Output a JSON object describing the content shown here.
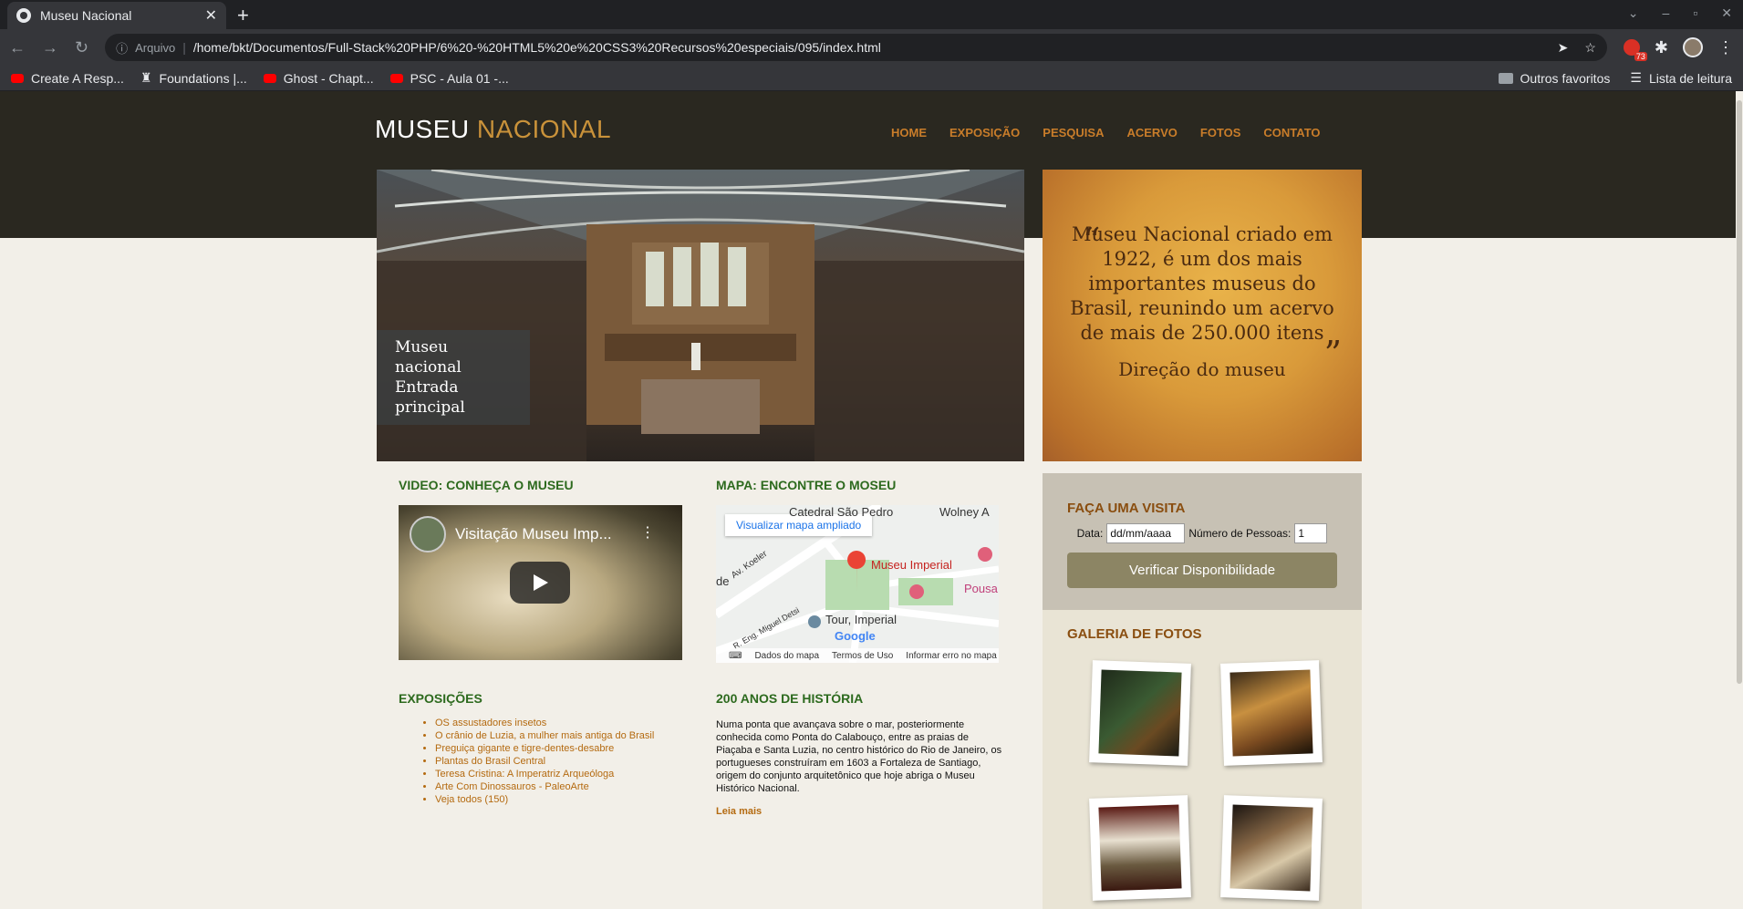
{
  "browser": {
    "tab_title": "Museu Nacional",
    "address_label": "Arquivo",
    "url": "/home/bkt/Documentos/Full-Stack%20PHP/6%20-%20HTML5%20e%20CSS3%20Recursos%20especiais/095/index.html",
    "extension_badge": "73",
    "bookmarks": [
      "Create A Resp...",
      "Foundations |...",
      "Ghost - Chapt...",
      "PSC - Aula 01 -..."
    ],
    "other_favorites": "Outros favoritos",
    "reading_list": "Lista de leitura"
  },
  "site": {
    "logo_main": "MUSEU",
    "logo_accent": "NACIONAL",
    "nav": [
      "HOME",
      "EXPOSIÇÃO",
      "PESQUISA",
      "ACERVO",
      "FOTOS",
      "CONTATO"
    ],
    "hero_caption_line1": "Museu nacional",
    "hero_caption_line2": "Entrada principal",
    "quote_open": "“",
    "quote_close": "”",
    "quote_text": "Museu Nacional criado em 1922, é um dos mais importantes museus do Brasil, reunindo um acervo de mais de 250.000 itens",
    "quote_sign": "Direção do museu",
    "visita": {
      "title": "FAÇA UMA VISITA",
      "date_label": "Data:",
      "date_placeholder": "dd/mm/aaaa",
      "people_label": "Número de Pessoas:",
      "people_value": "1",
      "button": "Verificar Disponibilidade"
    },
    "galeria_title": "GALERIA DE FOTOS",
    "video": {
      "heading": "VIDEO: CONHEÇA O MUSEU",
      "title": "Visitação Museu Imp...",
      "menu": "⋮"
    },
    "mapa": {
      "heading": "MAPA: ENCONTRE O MOSEU",
      "ampliado": "Visualizar mapa ampliado",
      "labels": [
        "Catedral São Pedro",
        "Wolney A",
        "Museu Imperial",
        "Pousa",
        "Tour, Imperial",
        "Av. Koeler",
        "R. Eng. Miguel Detsi",
        "de",
        "Google"
      ],
      "footer": [
        "Dados do mapa",
        "Termos de Uso",
        "Informar erro no mapa"
      ]
    },
    "exposicoes": {
      "heading": "EXPOSIÇÕES",
      "items": [
        "OS assustadores insetos",
        "O crânio de Luzia, a mulher mais antiga do Brasil",
        "Preguiça gigante e tigre-dentes-desabre",
        "Plantas do Brasil Central",
        "Teresa Cristina: A Imperatriz Arqueóloga",
        "Arte Com Dinossauros - PaleoArte",
        "Veja todos (150)"
      ]
    },
    "historia": {
      "heading": "200 ANOS DE HISTÓRIA",
      "text": "Numa ponta que avançava sobre o mar, posteriormente conhecida como Ponta do Calabouço, entre as praias de Piaçaba e Santa Luzia, no centro histórico do Rio de Janeiro, os portugueses construíram em 1603 a Fortaleza de Santiago, origem do conjunto arquitetônico que hoje abriga o Museu Histórico Nacional.",
      "more": "Leia mais"
    }
  }
}
